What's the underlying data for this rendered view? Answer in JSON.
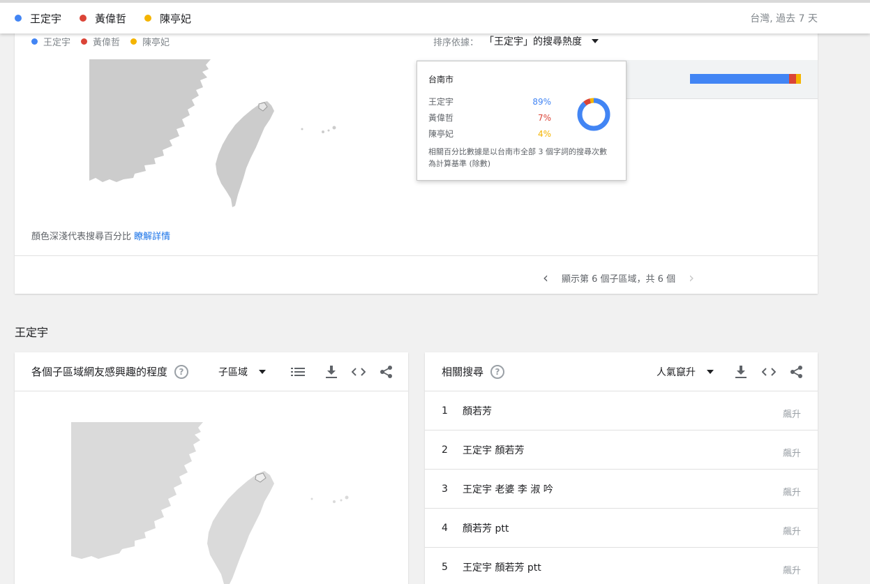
{
  "topbar": {
    "terms": [
      {
        "label": "王定宇",
        "color": "#4285f4"
      },
      {
        "label": "黃偉哲",
        "color": "#db4437"
      },
      {
        "label": "陳亭妃",
        "color": "#f4b400"
      }
    ],
    "meta": "台灣, 過去 7 天"
  },
  "region_card": {
    "legend": [
      {
        "label": "王定宇",
        "color": "#4285f4"
      },
      {
        "label": "黃偉哲",
        "color": "#db4437"
      },
      {
        "label": "陳亭妃",
        "color": "#f4b400"
      }
    ],
    "sort_label": "排序依據：",
    "sort_value": "「王定宇」的搜尋熱度",
    "bar_shares": [
      0.89,
      0.07,
      0.04
    ],
    "note_text": "顏色深淺代表搜尋百分比",
    "note_link": "瞭解詳情",
    "pager_text": "顯示第 6 個子區域，共 6 個",
    "tooltip": {
      "title": "台南市",
      "rows": [
        {
          "name": "王定宇",
          "pct": "89%",
          "color": "#4285f4",
          "share": 0.89
        },
        {
          "name": "黃偉哲",
          "pct": "7%",
          "color": "#db4437",
          "share": 0.07
        },
        {
          "name": "陳亭妃",
          "pct": "4%",
          "color": "#f4b400",
          "share": 0.04
        }
      ],
      "footnote": "相關百分比數據是以台南市全部 3 個字詞的搜尋次數為計算基準 (除數)"
    }
  },
  "section_title": "王定宇",
  "subregion_card": {
    "title": "各個子區域網友感興趣的程度",
    "help": "?",
    "dropdown": "子區域"
  },
  "related_card": {
    "title": "相關搜尋",
    "help": "?",
    "dropdown": "人氣竄升",
    "items": [
      {
        "num": "1",
        "query": "顏若芳",
        "tag": "飆升"
      },
      {
        "num": "2",
        "query": "王定宇 顏若芳",
        "tag": "飆升"
      },
      {
        "num": "3",
        "query": "王定宇 老婆 李 淑 吟",
        "tag": "飆升"
      },
      {
        "num": "4",
        "query": "顏若芳 ptt",
        "tag": "飆升"
      },
      {
        "num": "5",
        "query": "王定宇 顏若芳 ptt",
        "tag": "飆升"
      }
    ]
  },
  "icons": {
    "list": "list-icon",
    "download": "download-icon",
    "embed": "embed-icon",
    "share": "share-icon",
    "prev": "chevron-left-icon",
    "next": "chevron-right-icon"
  }
}
